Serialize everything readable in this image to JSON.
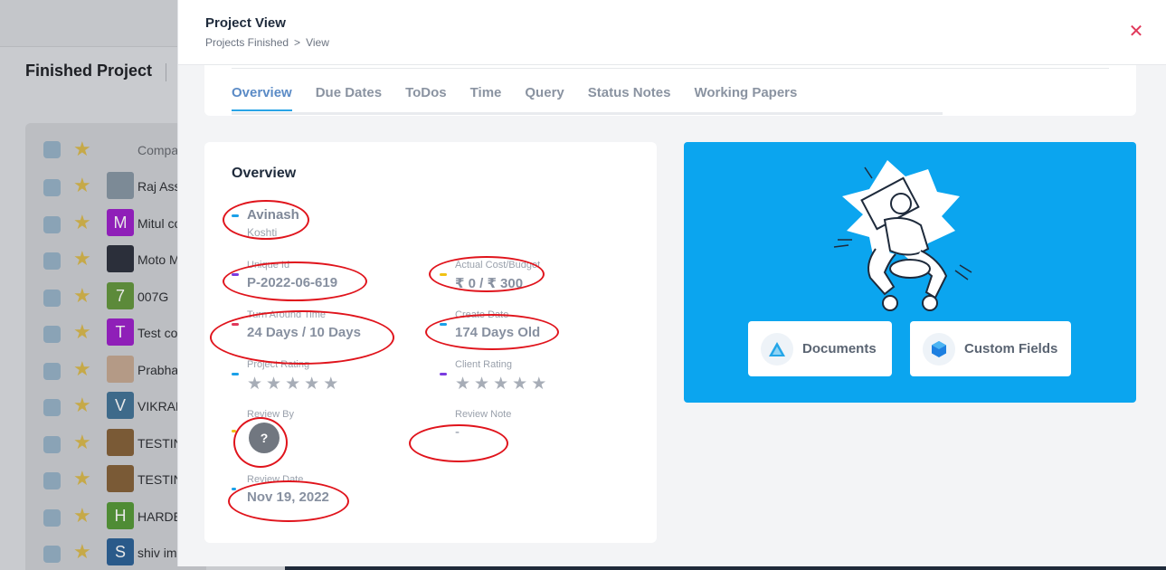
{
  "background": {
    "page_title": "Finished Project",
    "table_header_label": "Compa",
    "rows": [
      {
        "name": "Raj Ass",
        "initial": "",
        "color": "#7c8a96"
      },
      {
        "name": "Mitul co",
        "initial": "M",
        "color": "#8f1fb8"
      },
      {
        "name": "Moto M",
        "initial": "",
        "color": "#2b2f3a"
      },
      {
        "name": "007G",
        "initial": "7",
        "color": "#5c8a3a"
      },
      {
        "name": "Test co",
        "initial": "T",
        "color": "#8f1fb8"
      },
      {
        "name": "Prabha",
        "initial": "",
        "color": "#b49a86"
      },
      {
        "name": "VIKRAM",
        "initial": "V",
        "color": "#3e6a8a"
      },
      {
        "name": "TESTING",
        "initial": "",
        "color": "#7a5a36"
      },
      {
        "name": "TESTING",
        "initial": "",
        "color": "#7a5a36"
      },
      {
        "name": "HARDEI",
        "initial": "H",
        "color": "#4f8c35"
      },
      {
        "name": "shiv im",
        "initial": "S",
        "color": "#2a5a8a"
      }
    ]
  },
  "modal": {
    "title": "Project View",
    "breadcrumb": [
      "Projects Finished",
      ">",
      "View"
    ],
    "close_glyph": "✕",
    "tabs": [
      "Overview",
      "Due Dates",
      "ToDos",
      "Time",
      "Query",
      "Status Notes",
      "Working Papers"
    ],
    "overview": {
      "heading": "Overview",
      "person_name": "Avinash",
      "person_sub": "Koshti",
      "unique_id_label": "Unique Id",
      "unique_id": "P-2022-06-619",
      "cost_label": "Actual Cost/Budget",
      "cost": "₹ 0 / ₹ 300",
      "tat_label": "Turn Around Time",
      "tat": "24 Days / 10 Days",
      "create_label": "Create Date",
      "create": "174 Days Old",
      "project_rating_label": "Project Rating",
      "client_rating_label": "Client Rating",
      "review_by_label": "Review By",
      "review_by_avatar": "?",
      "review_note_label": "Review Note",
      "review_note": "-",
      "review_date_label": "Review Date",
      "review_date": "Nov 19, 2022"
    },
    "actions": {
      "documents": "Documents",
      "custom_fields": "Custom Fields"
    }
  },
  "colors": {
    "accent_blue": "#0ba5ef",
    "tab_active": "#5b8bc6",
    "close_red": "#e0385a",
    "marker_red": "#e0141c"
  }
}
